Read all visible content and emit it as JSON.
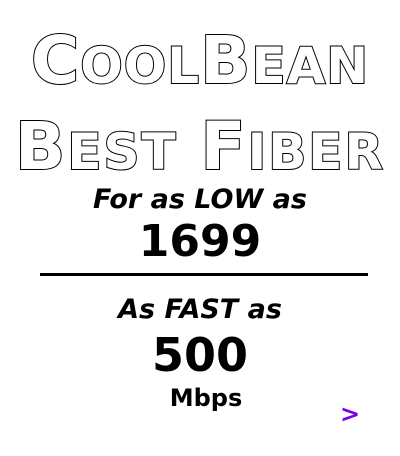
{
  "ad": {
    "brand_lead_C": "C",
    "brand_mid": "OOL",
    "brand_B": "B",
    "brand_tail": "EAN",
    "product_B": "B",
    "product_est": "EST",
    "product_F": "F",
    "product_iber": "IBER",
    "low_label": "For as LOW as",
    "low_price": "1699",
    "fast_label": "As FAST as",
    "fast_speed": "500",
    "speed_unit": "Mbps",
    "next_arrow": ">"
  },
  "colors": {
    "background": "#ffffff",
    "text": "#000000",
    "arrow": "#7a00e6"
  },
  "icons": {
    "next": "chevron-right-icon"
  }
}
